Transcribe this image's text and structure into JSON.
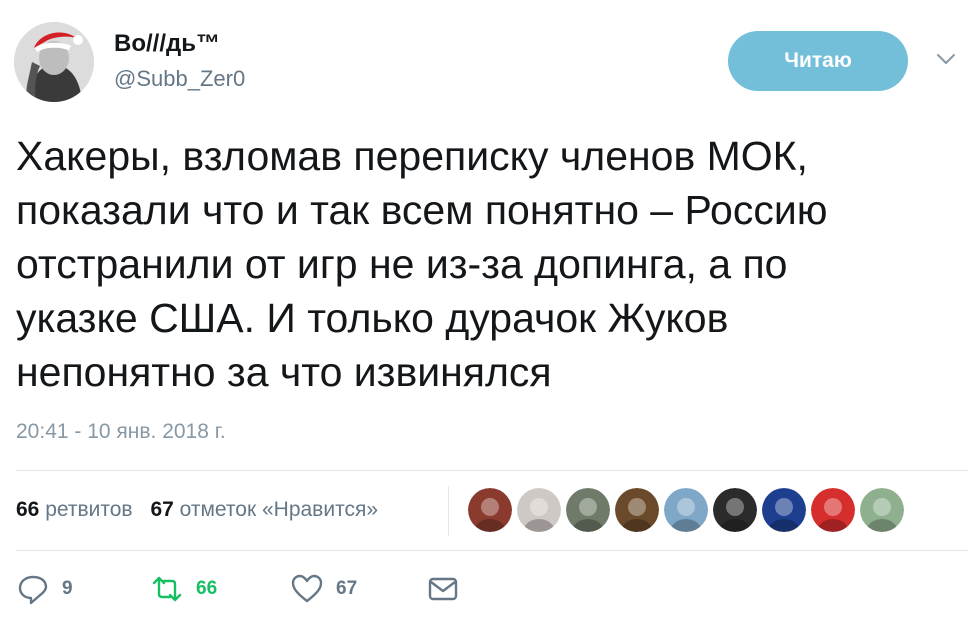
{
  "user": {
    "name": "Во///дь™",
    "handle": "@Subb_Zer0"
  },
  "follow_button_label": "Читаю",
  "tweet": {
    "lines": [
      "Хакеры, взломав переписку членов МОК,",
      "показали что и так всем понятно – Россию",
      "отстранили от игр не из-за допинга, а по",
      "указке США. И только дурачок Жуков",
      "непонятно за что извинялся"
    ],
    "timestamp": "20:41 - 10 янв. 2018 г."
  },
  "stats": {
    "retweets_count": "66",
    "retweets_label": "ретвитов",
    "likes_count": "67",
    "likes_label": "отметок «Нравится»"
  },
  "likers": [
    {
      "name": "liker-avatar-1",
      "color": "#8a3b2e"
    },
    {
      "name": "liker-avatar-2",
      "color": "#cfc9c6"
    },
    {
      "name": "liker-avatar-3",
      "color": "#6f7a68"
    },
    {
      "name": "liker-avatar-4",
      "color": "#6a4a2a"
    },
    {
      "name": "liker-avatar-5",
      "color": "#7fa7c7"
    },
    {
      "name": "liker-avatar-6",
      "color": "#2b2b2b"
    },
    {
      "name": "liker-avatar-7",
      "color": "#1e3f8f"
    },
    {
      "name": "liker-avatar-8",
      "color": "#d62d2d"
    },
    {
      "name": "liker-avatar-9",
      "color": "#8fb08f"
    }
  ],
  "actions": {
    "reply_count": "9",
    "retweet_count": "66",
    "like_count": "67"
  },
  "colors": {
    "follow_button": "#73bfd9",
    "text": "#14171a",
    "secondary_text": "#657786",
    "retweet_green": "#17bf63"
  }
}
